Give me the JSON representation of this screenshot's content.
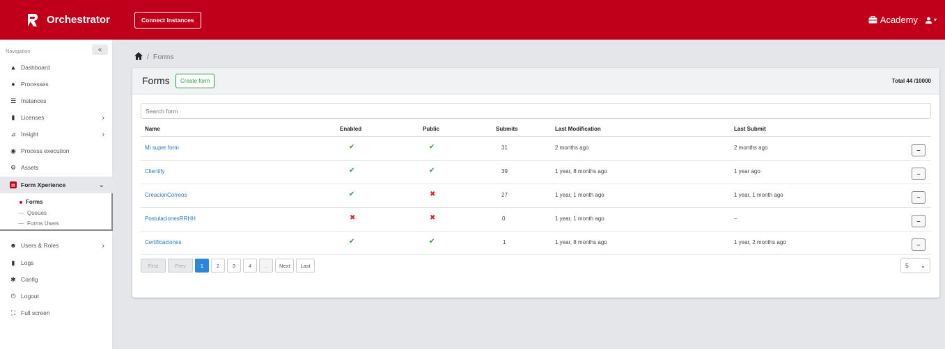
{
  "topbar": {
    "app_name": "Orchestrator",
    "connect_label": "Connect Instances",
    "org_label": "Academy"
  },
  "sidebar": {
    "header": "Navigation",
    "collapse_glyph": "«",
    "items": [
      {
        "label": "Dashboard",
        "icon": "home-icon"
      },
      {
        "label": "Processes",
        "icon": "database-icon"
      },
      {
        "label": "Instances",
        "icon": "server-icon"
      },
      {
        "label": "Licenses",
        "icon": "file-icon"
      },
      {
        "label": "Insight",
        "icon": "chart-icon"
      },
      {
        "label": "Process execution",
        "icon": "execution-icon"
      },
      {
        "label": "Assets",
        "icon": "assets-icon"
      },
      {
        "label": "Form Xperience",
        "icon": "form-icon"
      },
      {
        "label": "Users & Roles",
        "icon": "users-icon"
      },
      {
        "label": "Logs",
        "icon": "logs-icon"
      },
      {
        "label": "Config",
        "icon": "gear-icon"
      },
      {
        "label": "Logout",
        "icon": "power-icon"
      },
      {
        "label": "Full screen",
        "icon": "fullscreen-icon"
      }
    ],
    "sub_items": [
      {
        "label": "Forms"
      },
      {
        "label": "Queues"
      },
      {
        "label": "Forms Users"
      }
    ]
  },
  "breadcrumb": {
    "current": "Forms"
  },
  "forms": {
    "title": "Forms",
    "create_label": "Create form",
    "total": "Total 44 /10000",
    "search_placeholder": "Search form",
    "columns": [
      "Name",
      "Enabled",
      "Public",
      "Submits",
      "Last Modification",
      "Last Submit"
    ],
    "rows": [
      {
        "name": "Mi super form",
        "enabled": "✔",
        "public": "✔",
        "submits": "31",
        "last_modification": "2 months ago",
        "last_submit": "2 months ago"
      },
      {
        "name": "Clientify",
        "enabled": "✔",
        "public": "✔",
        "submits": "39",
        "last_modification": "1 year, 8 months ago",
        "last_submit": "1 year ago"
      },
      {
        "name": "CreacionCorreos",
        "enabled": "✔",
        "public": "✖",
        "submits": "27",
        "last_modification": "1 year, 1 month ago",
        "last_submit": "1 year, 1 month ago"
      },
      {
        "name": "PostulacionesRRHH",
        "enabled": "✖",
        "public": "✖",
        "submits": "0",
        "last_modification": "1 year, 1 month ago",
        "last_submit": "–"
      },
      {
        "name": "Certificaciones",
        "enabled": "✔",
        "public": "✔",
        "submits": "1",
        "last_modification": "1 year, 8 months ago",
        "last_submit": "1 year, 2 months ago"
      }
    ],
    "row_menu_glyph": "–"
  },
  "pagination": {
    "first": "First",
    "prev": "Prev",
    "pages": [
      "1",
      "2",
      "3",
      "4"
    ],
    "ellipsis": "...",
    "next": "Next",
    "last": "Last",
    "page_size": "5"
  },
  "colors": {
    "brand": "#c0001a",
    "accent": "#2d87d8",
    "success": "#2e9b3f",
    "danger": "#e0202a"
  }
}
